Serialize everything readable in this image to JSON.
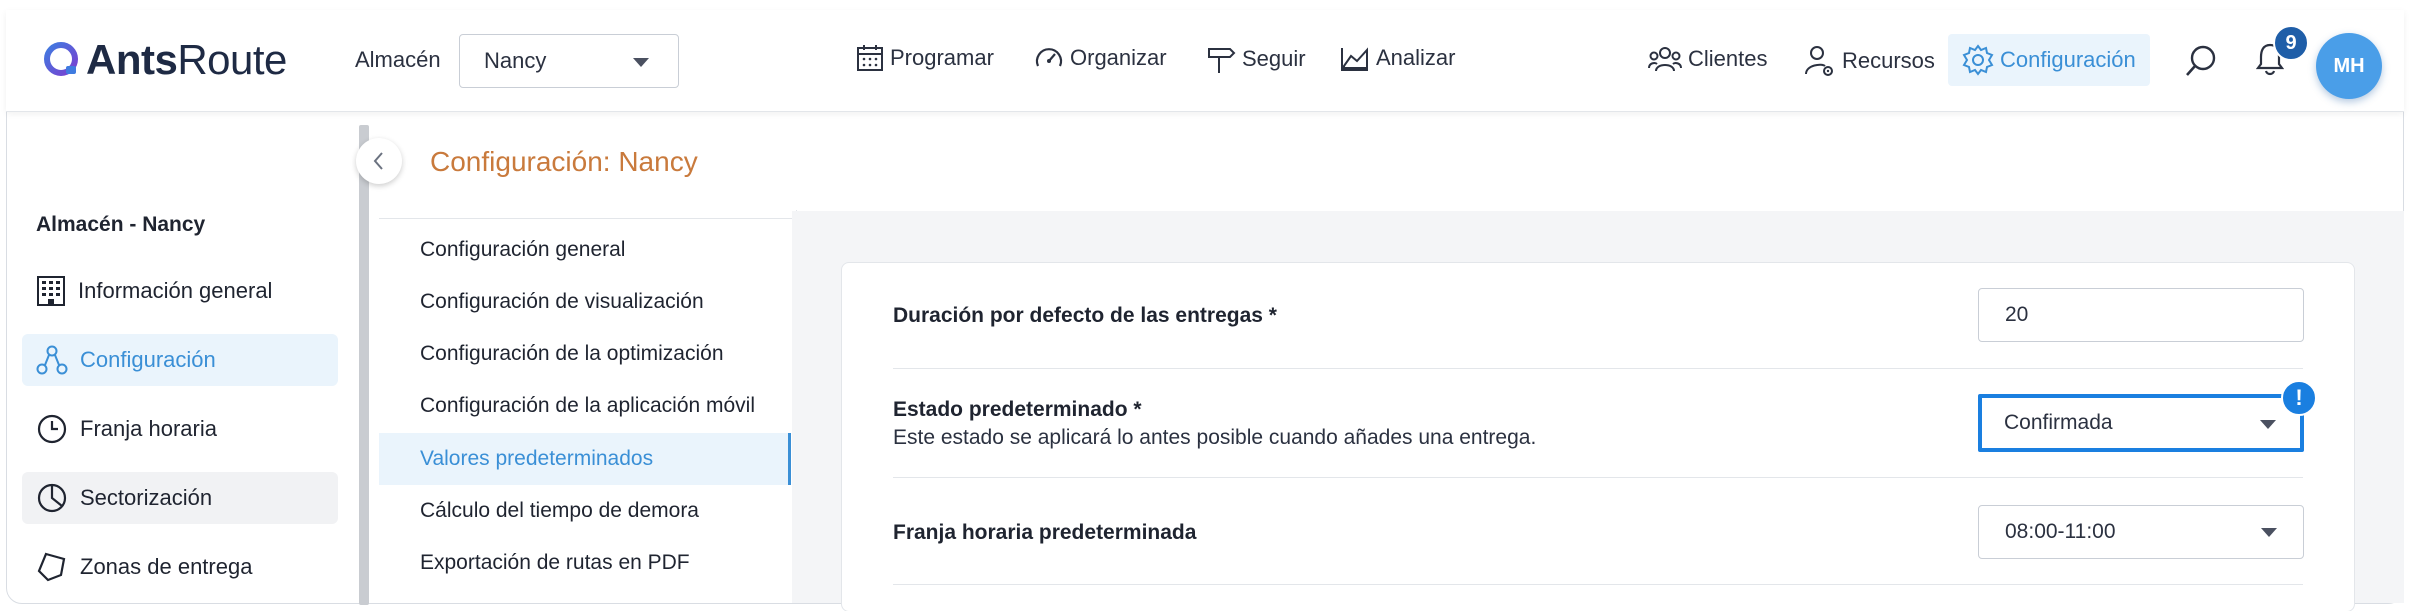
{
  "app": {
    "logo_bold": "Ants",
    "logo_light": "Route"
  },
  "header": {
    "store_label": "Almacén",
    "store_value": "Nancy",
    "nav": {
      "programar": "Programar",
      "organizar": "Organizar",
      "seguir": "Seguir",
      "analizar": "Analizar",
      "clientes": "Clientes",
      "recursos": "Recursos",
      "configuracion": "Configuración"
    },
    "notifications_count": "9",
    "avatar_initials": "MH"
  },
  "sidebar": {
    "title": "Almacén - Nancy",
    "items": [
      {
        "label": "Información general"
      },
      {
        "label": "Configuración"
      },
      {
        "label": "Franja horaria"
      },
      {
        "label": "Sectorización"
      },
      {
        "label": "Zonas de entrega"
      }
    ]
  },
  "page": {
    "title": "Configuración: Nancy"
  },
  "config_nav": [
    {
      "label": "Configuración general"
    },
    {
      "label": "Configuración de visualización"
    },
    {
      "label": "Configuración de la optimización"
    },
    {
      "label": "Configuración de la aplicación móvil"
    },
    {
      "label": "Valores predeterminados"
    },
    {
      "label": "Cálculo del tiempo de demora"
    },
    {
      "label": "Exportación de rutas en PDF"
    }
  ],
  "form": {
    "duration": {
      "label": "Duración por defecto de las entregas *",
      "value": "20"
    },
    "state": {
      "label": "Estado predeterminado *",
      "description": "Este estado se aplicará lo antes posible cuando añades una entrega.",
      "value": "Confirmada",
      "warning": "!"
    },
    "timeslot": {
      "label": "Franja horaria predeterminada",
      "value": "08:00-11:00"
    }
  },
  "colors": {
    "accent": "#3a8fd6",
    "title": "#c97a3c",
    "focus": "#1a7fe0",
    "badge": "#1f5ea8"
  }
}
